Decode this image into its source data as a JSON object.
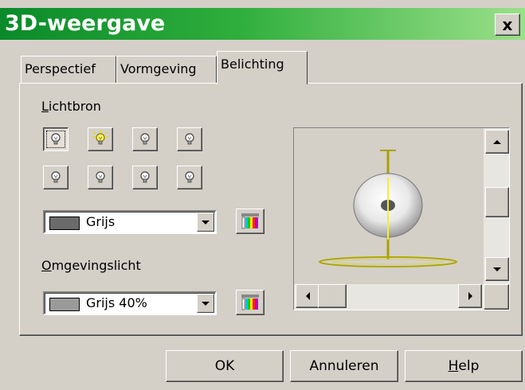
{
  "window": {
    "title": "3D-weergave",
    "close_label": "x"
  },
  "tabs": [
    {
      "label": "Perspectief"
    },
    {
      "label": "Vormgeving"
    },
    {
      "label": "Belichting"
    }
  ],
  "lighting": {
    "lightsource_label_u": "L",
    "lightsource_label_rest": "ichtbron",
    "light_color": {
      "value": "Grijs",
      "swatch": "#6b6b6b"
    },
    "ambient_label_u": "O",
    "ambient_label_rest": "mgevingslicht",
    "ambient_color": {
      "value": "Grijs 40%",
      "swatch": "#9a9a9a"
    }
  },
  "buttons": {
    "ok": "OK",
    "cancel": "Annuleren",
    "help_u": "H",
    "help_rest": "elp"
  }
}
